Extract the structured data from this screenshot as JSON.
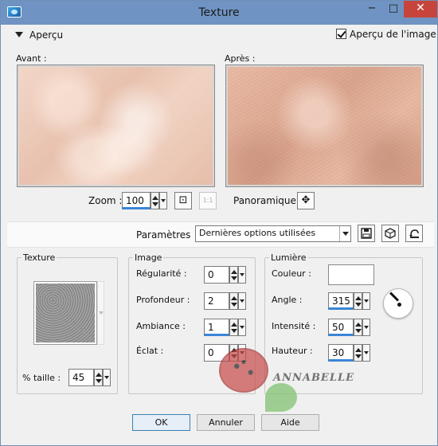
{
  "window": {
    "title": "Texture",
    "minimize": "−",
    "maximize": "□",
    "close": "✕"
  },
  "apercu": {
    "section_label": "Aperçu",
    "checkbox_label": "Aperçu de l'image",
    "checked": true
  },
  "preview": {
    "before_label": "Avant :",
    "after_label": "Après :"
  },
  "zoom": {
    "label": "Zoom :",
    "value": "100",
    "fit_icon": "fit-window-icon",
    "actual_size_label": "1:1"
  },
  "panoramique": {
    "label": "Panoramique :",
    "icon_glyph": "✥"
  },
  "parametres": {
    "label": "Paramètres",
    "selected": "Dernières options utilisées",
    "icons": [
      "save-icon",
      "random-dice-icon",
      "reset-icon"
    ]
  },
  "texture_group": {
    "title": "Texture",
    "size_label": "% taille :",
    "size_value": "45"
  },
  "image_group": {
    "title": "Image",
    "fields": [
      {
        "label": "Régularité :",
        "value": "0"
      },
      {
        "label": "Profondeur :",
        "value": "2"
      },
      {
        "label": "Ambiance :",
        "value": "1"
      },
      {
        "label": "Éclat :",
        "value": "0"
      }
    ]
  },
  "lumiere_group": {
    "title": "Lumière",
    "color_label": "Couleur :",
    "color_value": "#ffffff",
    "fields": [
      {
        "label": "Angle :",
        "value": "315"
      },
      {
        "label": "Intensité :",
        "value": "50"
      },
      {
        "label": "Hauteur :",
        "value": "30"
      }
    ]
  },
  "watermark": {
    "text": "ANNABELLE"
  },
  "buttons": {
    "ok": "OK",
    "cancel": "Annuler",
    "help": "Aide"
  }
}
